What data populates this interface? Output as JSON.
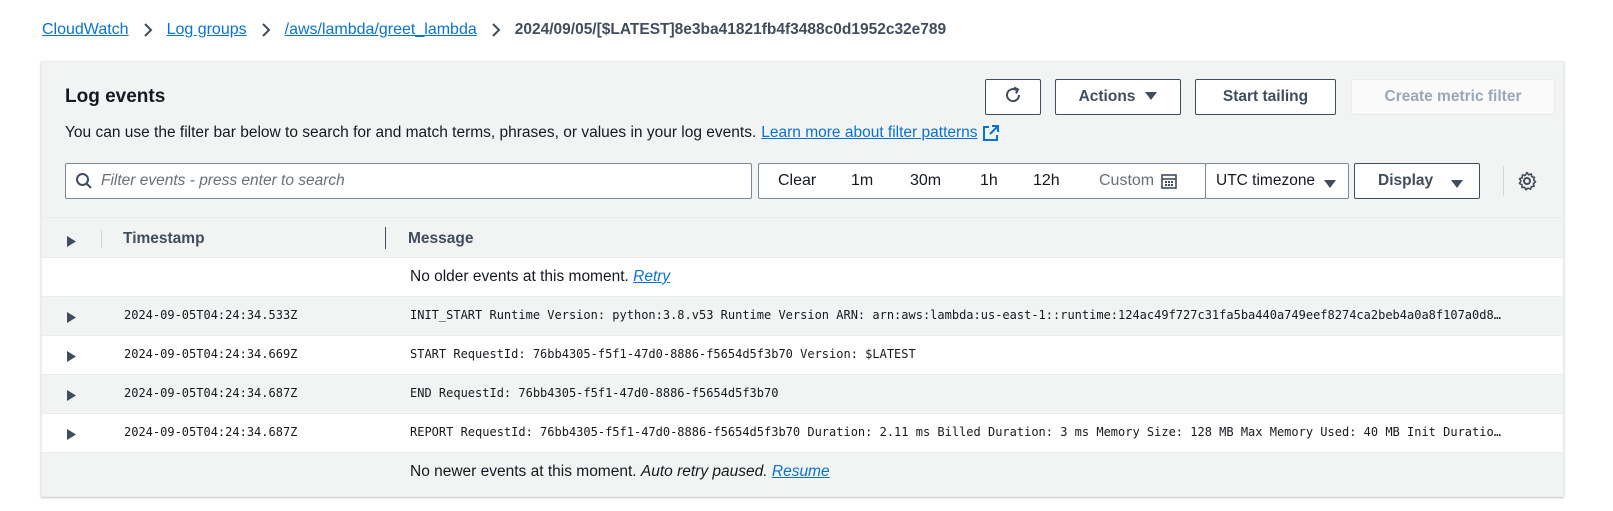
{
  "breadcrumb": {
    "items": [
      "CloudWatch",
      "Log groups",
      "/aws/lambda/greet_lambda"
    ],
    "current": "2024/09/05/[$LATEST]8e3ba41821fb4f3488c0d1952c32e789"
  },
  "panel": {
    "title": "Log events",
    "description": "You can use the filter bar below to search for and match terms, phrases, or values in your log events.",
    "learn_more": "Learn more about filter patterns"
  },
  "toolbar": {
    "actions_label": "Actions",
    "start_tailing_label": "Start tailing",
    "create_metric_filter_label": "Create metric filter"
  },
  "filter": {
    "placeholder": "Filter events - press enter to search",
    "value": "",
    "clear_label": "Clear",
    "ranges": [
      "1m",
      "30m",
      "1h",
      "12h"
    ],
    "custom_label": "Custom",
    "timezone": "UTC timezone",
    "display_label": "Display"
  },
  "table": {
    "columns": [
      "Timestamp",
      "Message"
    ],
    "top_notice": {
      "text": "No older events at this moment.",
      "link": "Retry"
    },
    "rows": [
      {
        "timestamp": "2024-09-05T04:24:34.533Z",
        "message": "INIT_START Runtime Version: python:3.8.v53 Runtime Version ARN: arn:aws:lambda:us-east-1::runtime:124ac49f727c31fa5ba440a749eef8274ca2beb4a0a8f107a0d8…"
      },
      {
        "timestamp": "2024-09-05T04:24:34.669Z",
        "message": "START RequestId: 76bb4305-f5f1-47d0-8886-f5654d5f3b70 Version: $LATEST"
      },
      {
        "timestamp": "2024-09-05T04:24:34.687Z",
        "message": "END RequestId: 76bb4305-f5f1-47d0-8886-f5654d5f3b70"
      },
      {
        "timestamp": "2024-09-05T04:24:34.687Z",
        "message": "REPORT RequestId: 76bb4305-f5f1-47d0-8886-f5654d5f3b70 Duration: 2.11 ms Billed Duration: 3 ms Memory Size: 128 MB Max Memory Used: 40 MB Init Duratio…"
      }
    ],
    "bottom_notice": {
      "text": "No newer events at this moment.",
      "italic": "Auto retry paused.",
      "link": "Resume"
    }
  },
  "colors": {
    "link": "#0972d3",
    "text": "#16191f",
    "panel_bg": "#f2f3f3",
    "button_border": "#414d5c"
  },
  "icons": [
    "chevron-right-icon",
    "refresh-icon",
    "caret-down-icon",
    "external-link-icon",
    "search-icon",
    "calendar-icon",
    "gear-icon",
    "caret-right-icon"
  ]
}
